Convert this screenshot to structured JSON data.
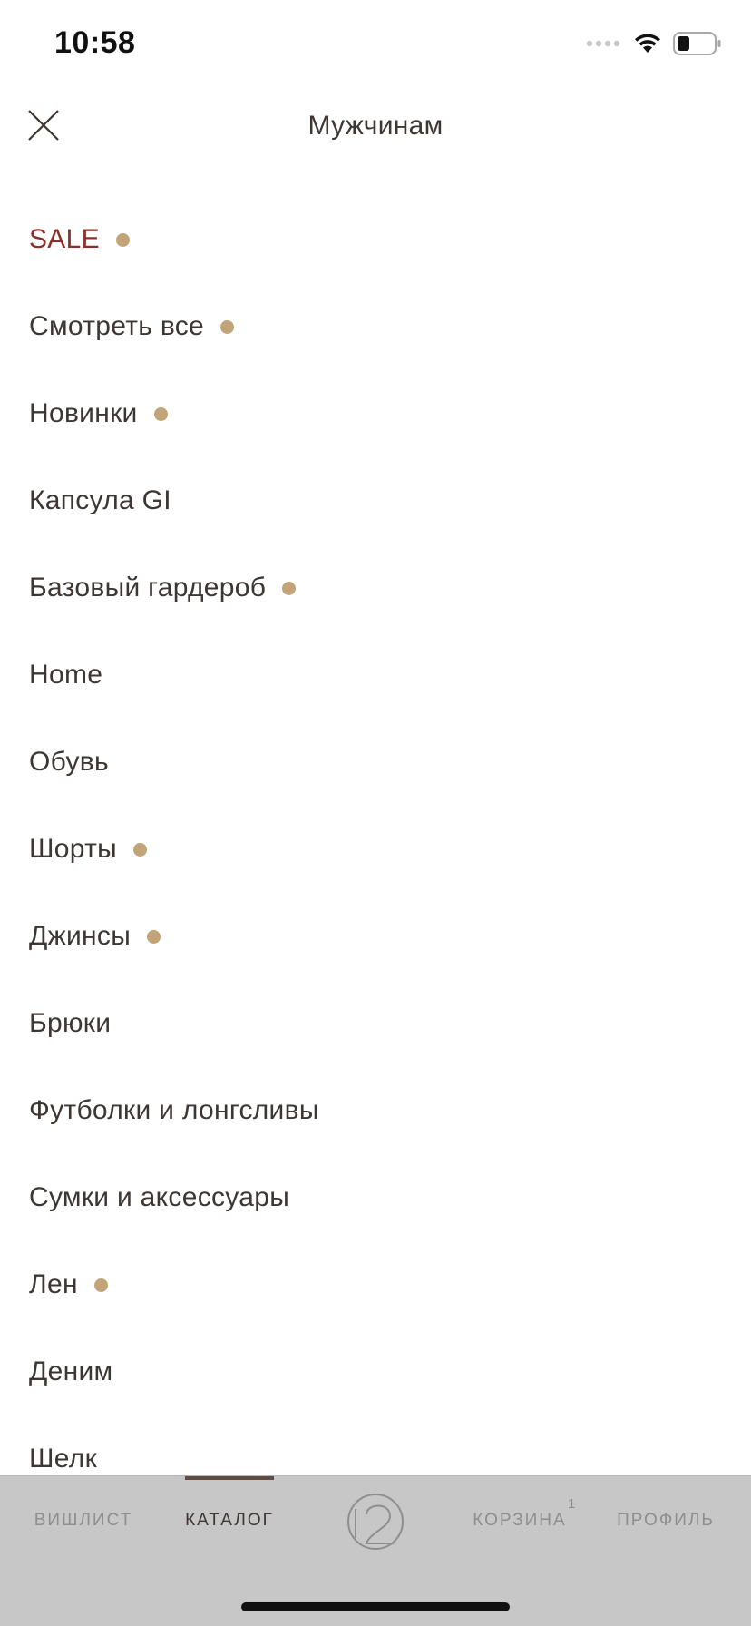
{
  "status_bar": {
    "time": "10:58",
    "icons": [
      "signal-icon",
      "wifi-icon",
      "battery-icon"
    ]
  },
  "header": {
    "title": "Мужчинам",
    "close_icon": "close-icon"
  },
  "colors": {
    "text": "#3d3632",
    "sale": "#8c2f2b",
    "new_dot": "#c2a478",
    "tab_bar_bg": "#c7c7c7",
    "tab_inactive": "#8e8e8e"
  },
  "menu": {
    "items": [
      {
        "label": "SALE",
        "dot": true
      },
      {
        "label": "Смотреть все",
        "dot": true
      },
      {
        "label": "Новинки",
        "dot": true
      },
      {
        "label": "Капсула GI",
        "dot": false
      },
      {
        "label": "Базовый гардероб",
        "dot": true
      },
      {
        "label": "Home",
        "dot": false
      },
      {
        "label": "Обувь",
        "dot": false
      },
      {
        "label": "Шорты",
        "dot": true
      },
      {
        "label": "Джинсы",
        "dot": true
      },
      {
        "label": "Брюки",
        "dot": false
      },
      {
        "label": "Футболки и лонгсливы",
        "dot": false
      },
      {
        "label": "Сумки и аксессуары",
        "dot": false
      },
      {
        "label": "Лен",
        "dot": true
      },
      {
        "label": "Деним",
        "dot": false
      },
      {
        "label": "Шелк",
        "dot": false
      }
    ]
  },
  "tabs": {
    "wishlist": "ВИШЛИСТ",
    "catalog": "КАТАЛОГ",
    "home_logo": "logo-icon",
    "cart": "КОРЗИНА",
    "cart_badge": "1",
    "profile": "ПРОФИЛЬ",
    "active": "catalog"
  }
}
